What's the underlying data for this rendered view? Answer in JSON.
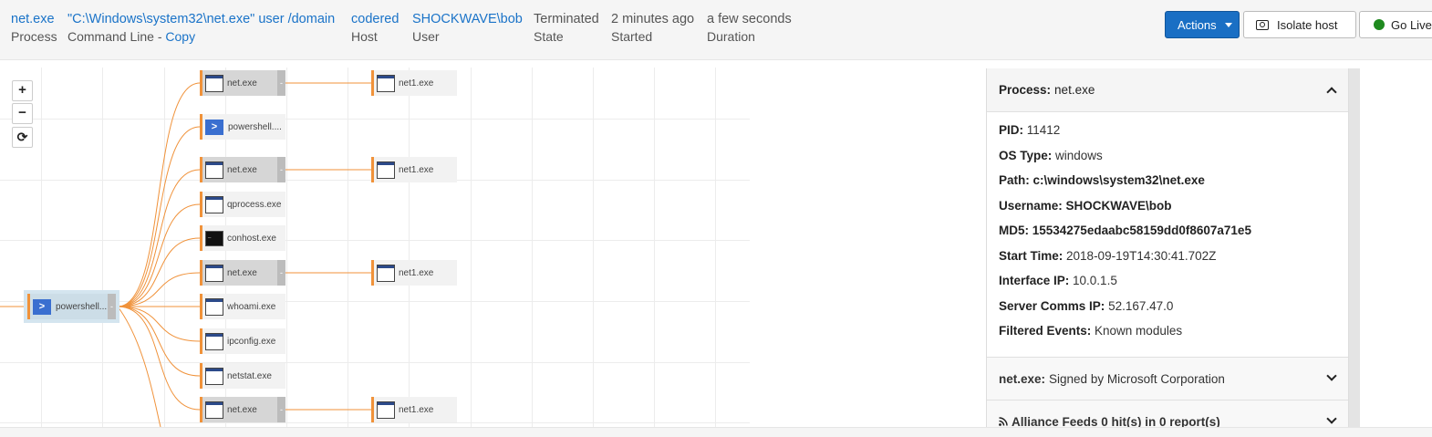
{
  "header": {
    "process_name": "net.exe",
    "process_label": "Process",
    "command_line": "\"C:\\Windows\\system32\\net.exe\" user /domain",
    "command_line_label": "Command Line - ",
    "copy_label": "Copy",
    "host": "codered",
    "host_label": "Host",
    "user": "SHOCKWAVE\\bob",
    "user_label": "User",
    "state": "Terminated",
    "state_label": "State",
    "started": "2 minutes ago",
    "started_label": "Started",
    "duration": "a few seconds",
    "duration_label": "Duration"
  },
  "toolbar": {
    "actions_label": "Actions",
    "isolate_label": "Isolate host",
    "golive_label": "Go Live",
    "golive_status_color": "#1f8a1f"
  },
  "graph": {
    "zoom_in": "+",
    "zoom_out": "−",
    "reset": "⟳",
    "root": {
      "label": "powershell....",
      "icon": "powershell-icon"
    },
    "children": [
      {
        "label": "net.exe",
        "icon": "window-icon",
        "child": "net1.exe"
      },
      {
        "label": "powershell....",
        "icon": "powershell-icon"
      },
      {
        "label": "net.exe",
        "icon": "window-icon",
        "child": "net1.exe"
      },
      {
        "label": "qprocess.exe",
        "icon": "window-icon"
      },
      {
        "label": "conhost.exe",
        "icon": "console-icon"
      },
      {
        "label": "net.exe",
        "icon": "window-icon",
        "child": "net1.exe"
      },
      {
        "label": "whoami.exe",
        "icon": "window-icon"
      },
      {
        "label": "ipconfig.exe",
        "icon": "window-icon"
      },
      {
        "label": "netstat.exe",
        "icon": "window-icon"
      },
      {
        "label": "net.exe",
        "icon": "window-icon",
        "child": "net1.exe"
      }
    ],
    "edge_color": "#f0923a"
  },
  "panel": {
    "process_title_label": "Process:",
    "process_title_value": "net.exe",
    "details": [
      {
        "label": "PID:",
        "value": "11412",
        "value_bold": false
      },
      {
        "label": "OS Type:",
        "value": "windows",
        "value_bold": false
      },
      {
        "label": "Path:",
        "value": "c:\\windows\\system32\\net.exe",
        "value_bold": true
      },
      {
        "label": "Username:",
        "value": "SHOCKWAVE\\bob",
        "value_bold": true
      },
      {
        "label": "MD5:",
        "value": "15534275edaabc58159dd0f8607a71e5",
        "value_bold": true
      },
      {
        "label": "Start Time:",
        "value": "2018-09-19T14:30:41.702Z",
        "value_bold": false
      },
      {
        "label": "Interface IP:",
        "value": "10.0.1.5",
        "value_bold": false
      },
      {
        "label": "Server Comms IP:",
        "value": "52.167.47.0",
        "value_bold": false
      },
      {
        "label": "Filtered Events:",
        "value": "Known modules",
        "value_bold": false
      }
    ],
    "signature_label": "net.exe:",
    "signature_value": "Signed by Microsoft Corporation",
    "alliance_label": "Alliance Feeds 0 hit(s) in 0 report(s)"
  }
}
